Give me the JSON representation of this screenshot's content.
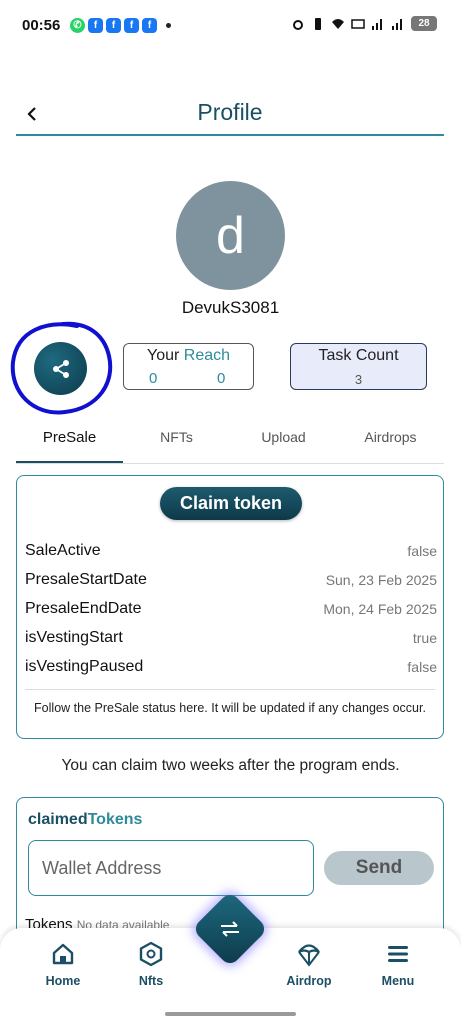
{
  "status_bar": {
    "time": "00:56",
    "battery": "28"
  },
  "header": {
    "title": "Profile"
  },
  "profile": {
    "avatar_letter": "d",
    "username": "DevukS3081"
  },
  "stats": {
    "reach_label_prefix": "Your",
    "reach_label_accent": "Reach",
    "reach_values": [
      "0",
      "0"
    ],
    "task_label": "Task Count",
    "task_value": "3"
  },
  "tabs": [
    {
      "label": "PreSale",
      "active": true
    },
    {
      "label": "NFTs",
      "active": false
    },
    {
      "label": "Upload",
      "active": false
    },
    {
      "label": "Airdrops",
      "active": false
    }
  ],
  "presale": {
    "claim_label": "Claim token",
    "rows": [
      {
        "key": "SaleActive",
        "value": "false"
      },
      {
        "key": "PresaleStartDate",
        "value": "Sun, 23 Feb 2025"
      },
      {
        "key": "PresaleEndDate",
        "value": "Mon, 24 Feb 2025"
      },
      {
        "key": "isVestingStart",
        "value": "true"
      },
      {
        "key": "isVestingPaused",
        "value": "false"
      }
    ],
    "note": "Follow the PreSale status here. It will be updated if any changes occur."
  },
  "claim_info": "You can claim two weeks after the program ends.",
  "claimed": {
    "title_prefix": "claimed",
    "title_accent": "Tokens",
    "wallet_placeholder": "Wallet Address",
    "send_label": "Send",
    "tokens_label": "Tokens",
    "tokens_nodata": "No data available"
  },
  "bottom_nav": [
    {
      "label": "Home",
      "icon": "home-icon"
    },
    {
      "label": "Nfts",
      "icon": "nft-icon"
    },
    {
      "label": "Airdrop",
      "icon": "airdrop-icon"
    },
    {
      "label": "Menu",
      "icon": "menu-icon"
    }
  ],
  "colors": {
    "primary": "#1b4f64",
    "accent": "#2e8b9c",
    "scribble": "#1010d0"
  }
}
